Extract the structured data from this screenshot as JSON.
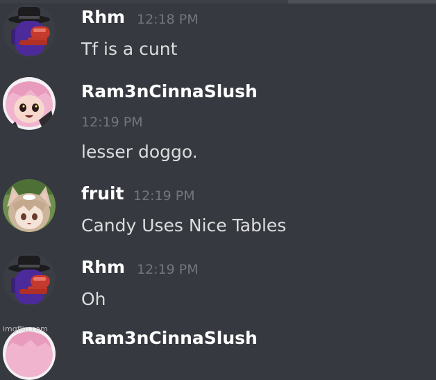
{
  "messages": [
    {
      "author": "Rhm",
      "time": "12:18 PM",
      "text": "Tf is a cunt",
      "avatar_icon": "among-us-crewmate-hat-icon"
    },
    {
      "author": "Ram3nCinnaSlush",
      "time": "12:19 PM",
      "text": "lesser doggo.",
      "avatar_icon": "anime-girl-pink-hair-icon"
    },
    {
      "author": "fruit",
      "time": "12:19 PM",
      "text": "Candy Uses Nice Tables",
      "avatar_icon": "anime-catgirl-icon"
    },
    {
      "author": "Rhm",
      "time": "12:19 PM",
      "text": "Oh",
      "avatar_icon": "among-us-crewmate-hat-icon"
    },
    {
      "author": "Ram3nCinnaSlush",
      "avatar_icon": "anime-girl-pink-hair-icon"
    }
  ],
  "watermark": "imgflip.com",
  "colors": {
    "background": "#36393f",
    "author": "#ffffff",
    "timestamp": "#72767d",
    "message": "#dcddde"
  }
}
